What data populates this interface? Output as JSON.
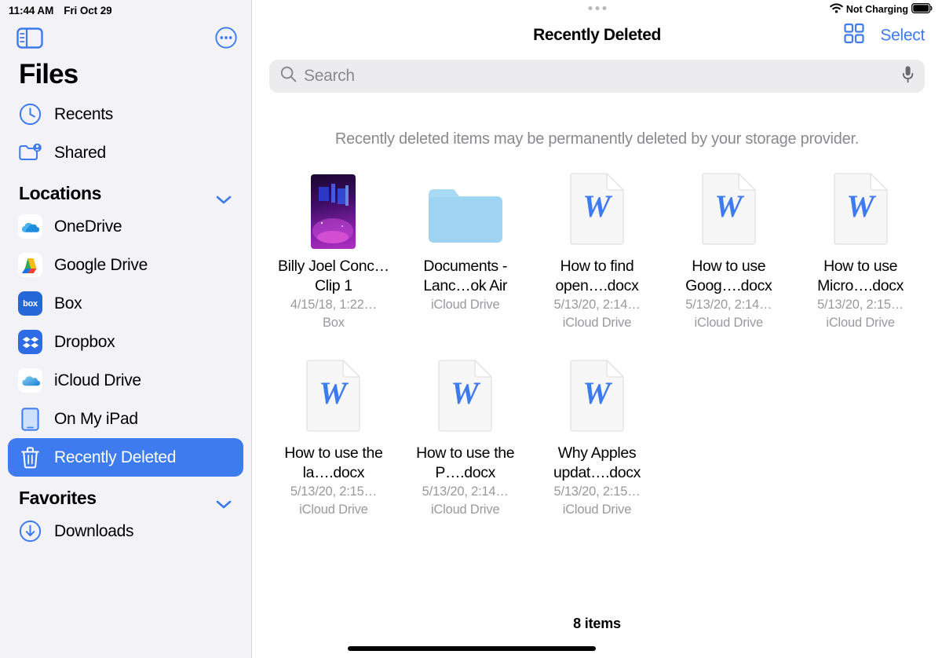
{
  "status_bar": {
    "time": "11:44 AM",
    "date": "Fri Oct 29",
    "battery_text": "Not Charging",
    "wifi_icon": "wifi-icon",
    "battery_icon": "battery-icon"
  },
  "sidebar": {
    "app_title": "Files",
    "toggle_icon": "sidebar-toggle-icon",
    "more_icon": "ellipsis-circle-icon",
    "top_items": [
      {
        "label": "Recents",
        "icon": "clock-icon"
      },
      {
        "label": "Shared",
        "icon": "shared-folder-icon"
      }
    ],
    "sections": [
      {
        "title": "Locations",
        "chevron_icon": "chevron-down-icon",
        "items": [
          {
            "label": "OneDrive",
            "icon": "onedrive-icon",
            "selected": false
          },
          {
            "label": "Google Drive",
            "icon": "google-drive-icon",
            "selected": false
          },
          {
            "label": "Box",
            "icon": "box-icon",
            "selected": false
          },
          {
            "label": "Dropbox",
            "icon": "dropbox-icon",
            "selected": false
          },
          {
            "label": "iCloud Drive",
            "icon": "icloud-drive-icon",
            "selected": false
          },
          {
            "label": "On My iPad",
            "icon": "ipad-icon",
            "selected": false
          },
          {
            "label": "Recently Deleted",
            "icon": "trash-icon",
            "selected": true
          }
        ]
      },
      {
        "title": "Favorites",
        "chevron_icon": "chevron-down-icon",
        "items": [
          {
            "label": "Downloads",
            "icon": "download-circle-icon",
            "selected": false
          }
        ]
      }
    ]
  },
  "main": {
    "title": "Recently Deleted",
    "grid_view_icon": "grid-view-icon",
    "select_label": "Select",
    "search": {
      "placeholder": "Search",
      "value": "",
      "search_icon": "search-icon",
      "mic_icon": "microphone-icon"
    },
    "notice": "Recently deleted items may be permanently deleted by your storage provider.",
    "items": [
      {
        "name": "Billy Joel Conc…Clip 1",
        "date": "4/15/18, 1:22…",
        "source": "Box",
        "icon": "video-thumbnail"
      },
      {
        "name": "Documents - Lanc…ok Air",
        "date": "iCloud Drive",
        "source": "",
        "icon": "folder-icon"
      },
      {
        "name": "How to find open….docx",
        "date": "5/13/20, 2:14…",
        "source": "iCloud Drive",
        "icon": "word-document-icon"
      },
      {
        "name": "How to use Goog….docx",
        "date": "5/13/20, 2:14…",
        "source": "iCloud Drive",
        "icon": "word-document-icon"
      },
      {
        "name": "How to use Micro….docx",
        "date": "5/13/20, 2:15…",
        "source": "iCloud Drive",
        "icon": "word-document-icon"
      },
      {
        "name": "How to use the la….docx",
        "date": "5/13/20, 2:15…",
        "source": "iCloud Drive",
        "icon": "word-document-icon"
      },
      {
        "name": "How to use the P….docx",
        "date": "5/13/20, 2:14…",
        "source": "iCloud Drive",
        "icon": "word-document-icon"
      },
      {
        "name": "Why Apples updat….docx",
        "date": "5/13/20, 2:15…",
        "source": "iCloud Drive",
        "icon": "word-document-icon"
      }
    ],
    "item_count_label": "8 items"
  },
  "colors": {
    "accent_blue": "#3d7bef",
    "sidebar_bg": "#f2f2f7",
    "search_bg": "#ececee",
    "meta_gray": "#9a9a9e"
  }
}
